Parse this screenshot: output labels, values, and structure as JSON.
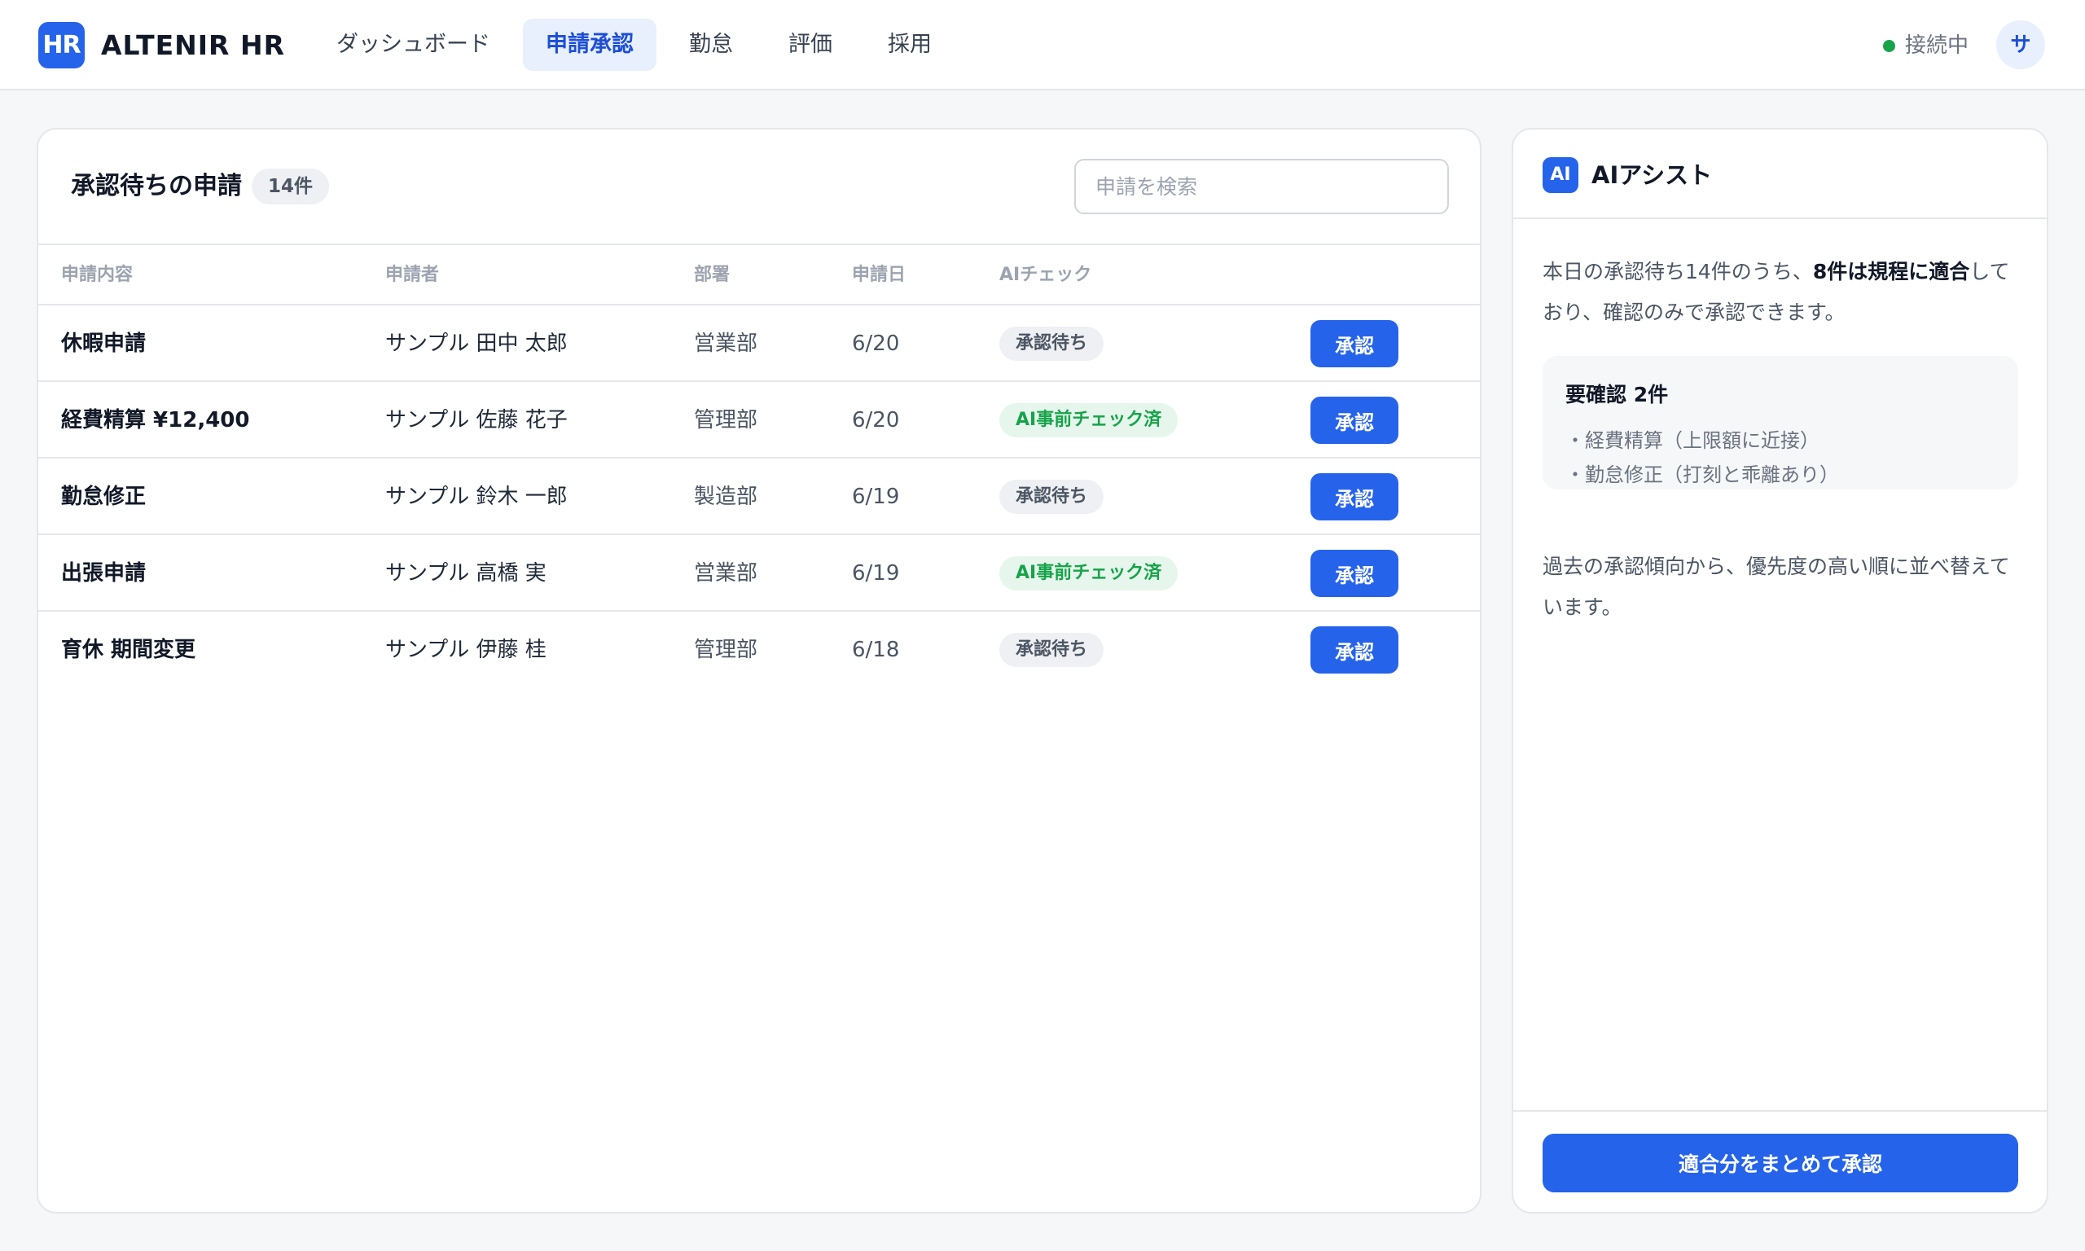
{
  "app": {
    "logo_mark": "HR",
    "name": "ALTENIR HR"
  },
  "nav": {
    "items": [
      {
        "label": "ダッシュボード",
        "active": false
      },
      {
        "label": "申請承認",
        "active": true
      },
      {
        "label": "勤怠",
        "active": false
      },
      {
        "label": "評価",
        "active": false
      },
      {
        "label": "採用",
        "active": false
      }
    ]
  },
  "status": {
    "label": "接続中",
    "color": "#16a34a",
    "icon": "status-dot-icon"
  },
  "user": {
    "avatar_initial": "サ"
  },
  "requests": {
    "title": "承認待ちの申請",
    "count_badge": "14件",
    "search_placeholder": "申請を検索",
    "columns": [
      "申請内容",
      "申請者",
      "部署",
      "申請日",
      "AIチェック"
    ],
    "approve_label": "承認",
    "rows": [
      {
        "title": "休暇申請",
        "applicant": "サンプル 田中 太郎",
        "dept": "営業部",
        "date": "6/20",
        "ai_check": "承認待ち",
        "ai_status": "pending"
      },
      {
        "title": "経費精算 ¥12,400",
        "applicant": "サンプル 佐藤 花子",
        "dept": "管理部",
        "date": "6/20",
        "ai_check": "AI事前チェック済",
        "ai_status": "checked"
      },
      {
        "title": "勤怠修正",
        "applicant": "サンプル 鈴木 一郎",
        "dept": "製造部",
        "date": "6/19",
        "ai_check": "承認待ち",
        "ai_status": "pending"
      },
      {
        "title": "出張申請",
        "applicant": "サンプル 高橋 実",
        "dept": "営業部",
        "date": "6/19",
        "ai_check": "AI事前チェック済",
        "ai_status": "checked"
      },
      {
        "title": "育休 期間変更",
        "applicant": "サンプル 伊藤 桂",
        "dept": "管理部",
        "date": "6/18",
        "ai_check": "承認待ち",
        "ai_status": "pending"
      }
    ]
  },
  "ai_assist": {
    "badge": "AI",
    "title": "AIアシスト",
    "summary_prefix": "本日の承認待ち14件のうち、",
    "summary_bold": "8件は規程に適合",
    "summary_suffix": "しており、確認のみで承認できます。",
    "review_title": "要確認 2件",
    "review_items": [
      "・経費精算（上限額に近接）",
      "・勤怠修正（打刻と乖離あり）"
    ],
    "note": "過去の承認傾向から、優先度の高い順に並べ替えています。",
    "bulk_button": "適合分をまとめて承認"
  },
  "colors": {
    "accent": "#2563eb",
    "success": "#16a34a",
    "chip_success_bg": "#e6f6ec"
  }
}
